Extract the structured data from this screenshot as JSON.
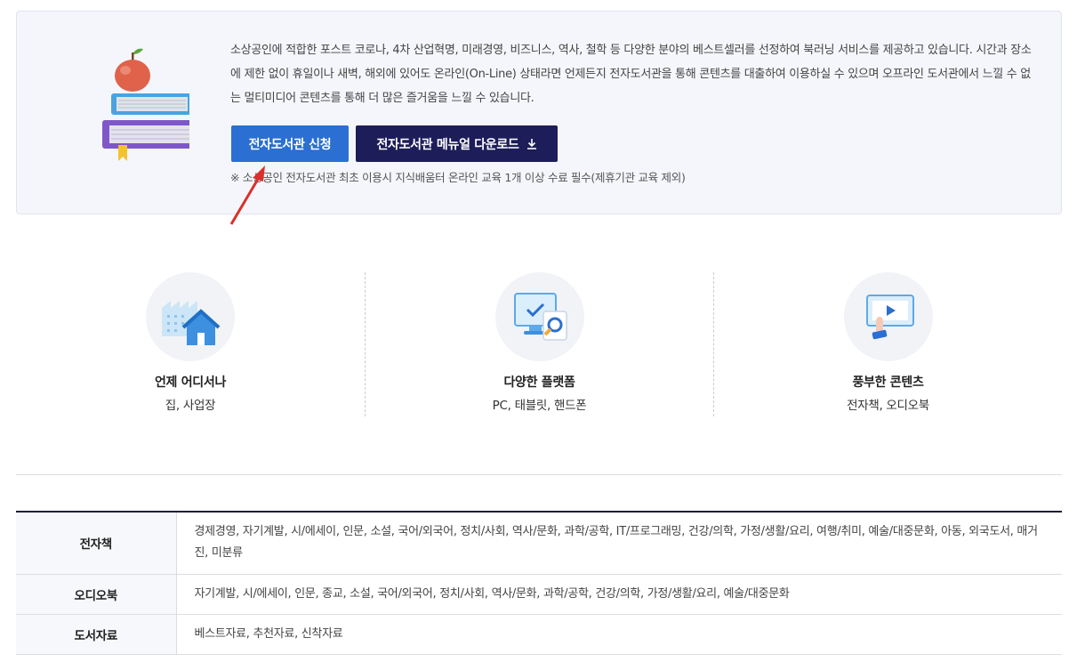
{
  "intro": {
    "description": "소상공인에 적합한 포스트 코로나, 4차 산업혁명, 미래경영, 비즈니스, 역사, 철학 등 다양한 분야의 베스트셀러를 선정하여 북러닝 서비스를 제공하고 있습니다. 시간과 장소에 제한 없이 휴일이나 새벽, 해외에 있어도 온라인(On-Line) 상태라면 언제든지 전자도서관을 통해 콘텐츠를 대출하여 이용하실 수 있으며 오프라인 도서관에서 느낄 수 없는 멀티미디어 콘텐츠를 통해 더 많은 즐거움을 느낄 수 있습니다.",
    "apply_button": "전자도서관 신청",
    "manual_button": "전자도서관 메뉴얼 다운로드",
    "notice": "※ 소상공인 전자도서관 최초 이용시 지식배움터 온라인 교육 1개 이상 수료 필수(제휴기관 교육 제외)",
    "colors": {
      "apply": "#2a6fd1",
      "manual": "#1d1d5a",
      "annotation_arrow": "#d9302c"
    }
  },
  "features": [
    {
      "icon": "home-building-icon",
      "title": "언제 어디서나",
      "sub": "집, 사업장"
    },
    {
      "icon": "monitor-search-icon",
      "title": "다양한 플랫폼",
      "sub": "PC, 태블릿, 핸드폰"
    },
    {
      "icon": "touch-screen-icon",
      "title": "풍부한 콘텐츠",
      "sub": "전자책, 오디오북"
    }
  ],
  "categories": [
    {
      "label": "전자책",
      "value": "경제경영, 자기계발, 시/에세이, 인문, 소설, 국어/외국어, 정치/사회, 역사/문화, 과학/공학, IT/프로그래밍, 건강/의학, 가정/생활/요리, 여행/취미, 예술/대중문화, 아동, 외국도서, 매거진, 미분류"
    },
    {
      "label": "오디오북",
      "value": "자기계발, 시/에세이, 인문, 종교, 소설, 국어/외국어, 정치/사회, 역사/문화, 과학/공학, 건강/의학, 가정/생활/요리, 예술/대중문화"
    },
    {
      "label": "도서자료",
      "value": "베스트자료, 추천자료, 신착자료"
    }
  ]
}
